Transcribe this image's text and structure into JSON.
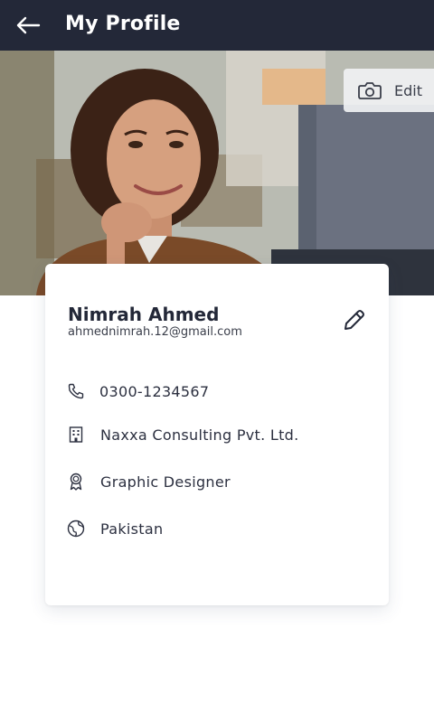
{
  "header": {
    "title": "My Profile",
    "back_icon": "arrow-left-icon"
  },
  "cover": {
    "edit_label": "Edit",
    "camera_icon": "camera-icon"
  },
  "profile": {
    "name": "Nimrah Ahmed",
    "email": "ahmednimrah.12@gmail.com",
    "edit_icon": "pencil-icon",
    "details": [
      {
        "icon": "phone-icon",
        "text": "0300-1234567"
      },
      {
        "icon": "building-icon",
        "text": "Naxxa Consulting Pvt. Ltd."
      },
      {
        "icon": "award-icon",
        "text": "Graphic Designer"
      },
      {
        "icon": "globe-icon",
        "text": "Pakistan"
      }
    ]
  },
  "colors": {
    "header_bg": "#232838",
    "text_primary": "#232838",
    "card_bg": "#ffffff"
  }
}
